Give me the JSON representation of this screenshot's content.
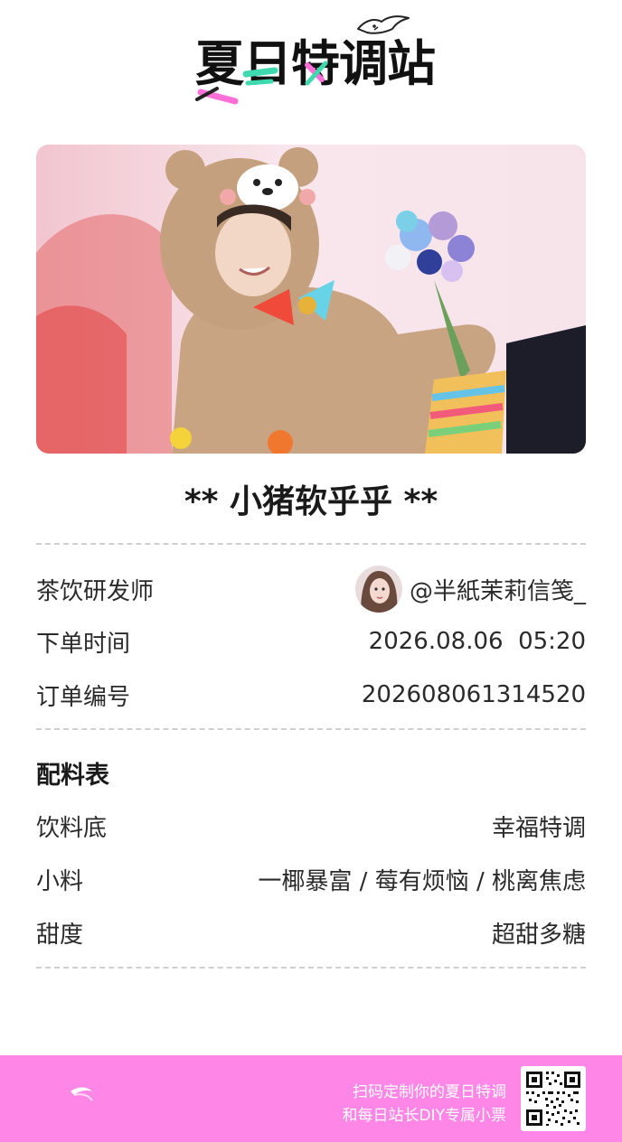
{
  "logo": {
    "text": "夏日特调站"
  },
  "product": {
    "title": "** 小猪软乎乎 **"
  },
  "order_info": {
    "developer_label": "茶饮研发师",
    "developer_name": "@半紙茉莉信笺_",
    "time_label": "下单时间",
    "time_value": "2026.08.06  05:20",
    "number_label": "订单编号",
    "number_value": "202608061314520"
  },
  "recipe": {
    "section_title": "配料表",
    "base_label": "饮料底",
    "base_value": "幸福特调",
    "toppings_label": "小料",
    "toppings_value": "一椰暴富 / 莓有烦恼 / 桃离焦虑",
    "sweetness_label": "甜度",
    "sweetness_value": "超甜多糖"
  },
  "footer": {
    "line1": "扫码定制你的夏日特调",
    "line2": "和每日站长DIY专属小票",
    "qr_icon": "qr-code-icon",
    "background_color": "#fd86e6"
  },
  "colors": {
    "accent_pink": "#fd86e6",
    "logo_green": "#3fd9b0",
    "logo_pink": "#ff6fd8",
    "divider": "#cfcfcf"
  }
}
